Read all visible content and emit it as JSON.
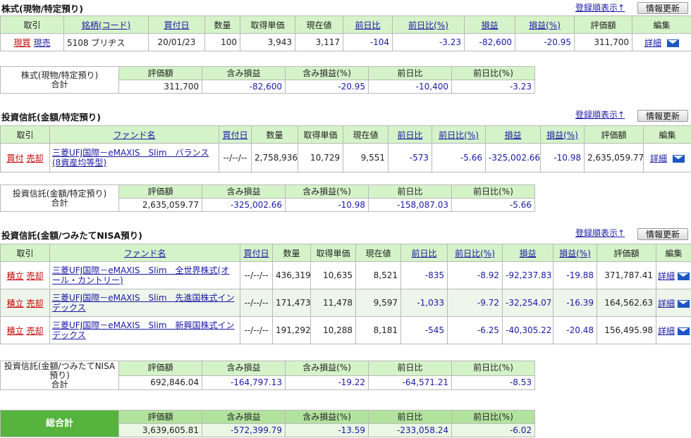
{
  "common": {
    "sort_link": "登録順表示",
    "refresh_button": "情報更新",
    "detail_label": "詳細",
    "nav_symbol": "↑"
  },
  "stock": {
    "title": "株式(現物/特定預り)",
    "headers": [
      "取引",
      "銘柄(コード)",
      "買付日",
      "数量",
      "取得単価",
      "現在値",
      "前日比",
      "前日比(%)",
      "損益",
      "損益(%)",
      "評価額",
      "編集"
    ],
    "row": {
      "buy": "現買",
      "sell": "現売",
      "name": "5108 ブリヂス",
      "date": "20/01/23",
      "qty": "100",
      "cost": "3,943",
      "price": "3,117",
      "chg": "-104",
      "chg_pct": "-3.23",
      "pl": "-82,600",
      "pl_pct": "-20.95",
      "value": "311,700"
    },
    "summary": {
      "label": "株式(現物/特定預り)",
      "total": "合計",
      "headers": [
        "評価額",
        "含み損益",
        "含み損益(%)",
        "前日比",
        "前日比(%)"
      ],
      "values": [
        "311,700",
        "-82,600",
        "-20.95",
        "-10,400",
        "-3.23"
      ]
    }
  },
  "fund1": {
    "title": "投資信託(金額/特定預り)",
    "headers": [
      "取引",
      "ファンド名",
      "買付日",
      "数量",
      "取得単価",
      "現在値",
      "前日比",
      "前日比(%)",
      "損益",
      "損益(%)",
      "評価額",
      "編集"
    ],
    "row": {
      "buy": "買付",
      "sell": "売却",
      "name": "三菱UFJ国際－eMAXIS　Slim　バランス(8資産均等型)",
      "date": "--/--/--",
      "qty": "2,758,936",
      "cost": "10,729",
      "price": "9,551",
      "chg": "-573",
      "chg_pct": "-5.66",
      "pl": "-325,002.66",
      "pl_pct": "-10.98",
      "value": "2,635,059.77"
    },
    "summary": {
      "label": "投資信託(金額/特定預り)",
      "total": "合計",
      "headers": [
        "評価額",
        "含み損益",
        "含み損益(%)",
        "前日比",
        "前日比(%)"
      ],
      "values": [
        "2,635,059.77",
        "-325,002.66",
        "-10.98",
        "-158,087.03",
        "-5.66"
      ]
    }
  },
  "fund2": {
    "title": "投資信託(金額/つみたてNISA預り)",
    "headers": [
      "取引",
      "ファンド名",
      "買付日",
      "数量",
      "取得単価",
      "現在値",
      "前日比",
      "前日比(%)",
      "損益",
      "損益(%)",
      "評価額",
      "編集"
    ],
    "rows": [
      {
        "buy": "積立",
        "sell": "売却",
        "name": "三菱UFJ国際－eMAXIS　Slim　全世界株式(オール・カントリー)",
        "date": "--/--/--",
        "qty": "436,319",
        "cost": "10,635",
        "price": "8,521",
        "chg": "-835",
        "chg_pct": "-8.92",
        "pl": "-92,237.83",
        "pl_pct": "-19.88",
        "value": "371,787.41"
      },
      {
        "buy": "積立",
        "sell": "売却",
        "name": "三菱UFJ国際－eMAXIS　Slim　先進国株式インデックス",
        "date": "--/--/--",
        "qty": "171,473",
        "cost": "11,478",
        "price": "9,597",
        "chg": "-1,033",
        "chg_pct": "-9.72",
        "pl": "-32,254.07",
        "pl_pct": "-16.39",
        "value": "164,562.63"
      },
      {
        "buy": "積立",
        "sell": "売却",
        "name": "三菱UFJ国際－eMAXIS　Slim　新興国株式インデックス",
        "date": "--/--/--",
        "qty": "191,292",
        "cost": "10,288",
        "price": "8,181",
        "chg": "-545",
        "chg_pct": "-6.25",
        "pl": "-40,305.22",
        "pl_pct": "-20.48",
        "value": "156,495.98"
      }
    ],
    "summary": {
      "label": "投資信託(金額/つみたてNISA預り)",
      "total": "合計",
      "headers": [
        "評価額",
        "含み損益",
        "含み損益(%)",
        "前日比",
        "前日比(%)"
      ],
      "values": [
        "692,846.04",
        "-164,797.13",
        "-19.22",
        "-64,571.21",
        "-8.53"
      ]
    }
  },
  "grand": {
    "label": "総合計",
    "headers": [
      "評価額",
      "含み損益",
      "含み損益(%)",
      "前日比",
      "前日比(%)"
    ],
    "values": [
      "3,639,605.81",
      "-572,399.79",
      "-13.59",
      "-233,058.24",
      "-6.02"
    ]
  }
}
